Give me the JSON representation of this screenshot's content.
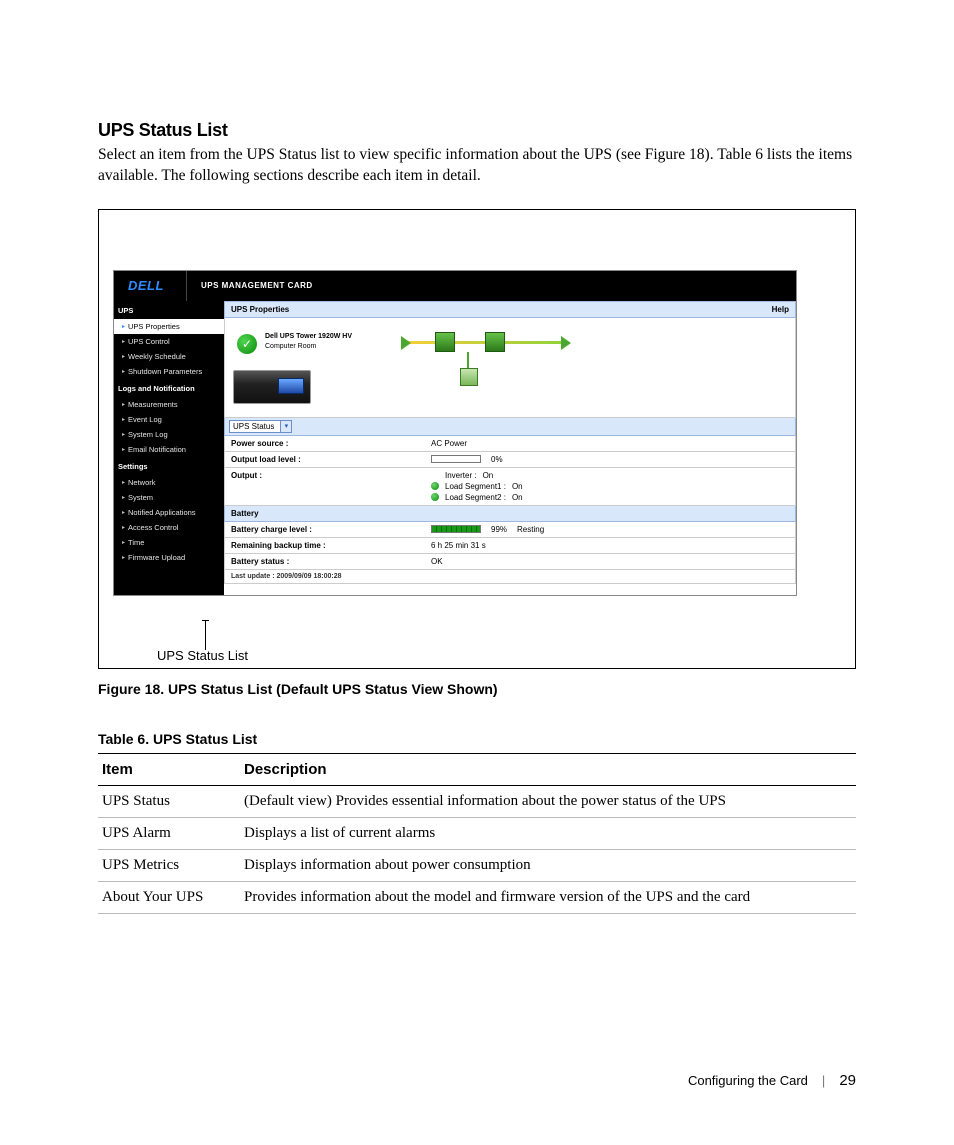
{
  "heading": "UPS Status List",
  "intro": "Select an item from the UPS Status list to view specific information about the UPS (see Figure 18). Table 6 lists the items available. The following sections describe each item in detail.",
  "callout_label": "UPS Status List",
  "figure_caption": "Figure 18. UPS Status List (Default UPS Status View Shown)",
  "table_caption": "Table 6. UPS Status List",
  "table_headers": {
    "item": "Item",
    "desc": "Description"
  },
  "table_rows": [
    {
      "item": "UPS Status",
      "desc": "(Default view) Provides essential information about the power status of the UPS"
    },
    {
      "item": "UPS Alarm",
      "desc": "Displays a list of current alarms"
    },
    {
      "item": "UPS Metrics",
      "desc": "Displays information about power consumption"
    },
    {
      "item": "About Your UPS",
      "desc": "Provides information about the model and firmware version of the UPS and the card"
    }
  ],
  "footer": {
    "section": "Configuring the Card",
    "page": "29"
  },
  "screenshot": {
    "logo": "DELL",
    "title": "UPS MANAGEMENT CARD",
    "nav": {
      "ups": {
        "header": "UPS",
        "items": [
          "UPS Properties",
          "UPS Control",
          "Weekly Schedule",
          "Shutdown Parameters"
        ]
      },
      "logs": {
        "header": "Logs and Notification",
        "items": [
          "Measurements",
          "Event Log",
          "System Log",
          "Email Notification"
        ]
      },
      "settings": {
        "header": "Settings",
        "items": [
          "Network",
          "System",
          "Notified Applications",
          "Access Control",
          "Time",
          "Firmware Upload"
        ]
      }
    },
    "panel": {
      "title": "UPS Properties",
      "help": "Help",
      "device_name": "Dell UPS Tower 1920W HV",
      "device_loc": "Computer Room",
      "dropdown": "UPS Status",
      "rows": {
        "power_source": {
          "k": "Power source :",
          "v": "AC Power"
        },
        "output_load": {
          "k": "Output load level :",
          "pct": "0%"
        },
        "output": {
          "k": "Output :",
          "inverter": {
            "label": "Inverter :",
            "state": "On"
          },
          "seg1": {
            "label": "Load Segment1 :",
            "state": "On"
          },
          "seg2": {
            "label": "Load Segment2 :",
            "state": "On"
          }
        },
        "battery_band": "Battery",
        "battery_charge": {
          "k": "Battery charge level :",
          "pct": "99%",
          "state": "Resting"
        },
        "backup": {
          "k": "Remaining backup time :",
          "v": "6 h 25 min 31 s"
        },
        "status": {
          "k": "Battery status :",
          "v": "OK"
        },
        "last_update": "Last update : 2009/09/09 18:00:28"
      }
    }
  }
}
